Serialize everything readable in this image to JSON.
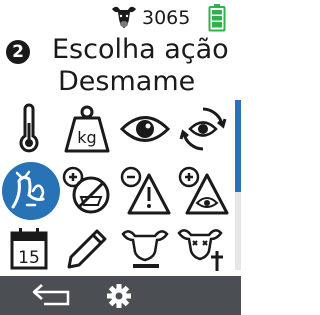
{
  "status_bar": {
    "animal_icon": "cow-head-icon",
    "animal_count": "3065",
    "battery_icon": "battery-full-icon",
    "battery_color": "#2fb24a"
  },
  "header": {
    "step_number": "2",
    "title": "Escolha ação",
    "subtitle": "Desmame"
  },
  "actions": [
    {
      "icon": "thermometer-icon"
    },
    {
      "icon": "weight-kg-icon"
    },
    {
      "icon": "eye-icon"
    },
    {
      "icon": "eye-rotate-icon"
    },
    {
      "icon": "weaning-cow-calf-icon",
      "selected": true
    },
    {
      "icon": "no-feeding-icon"
    },
    {
      "icon": "warning-minus-icon"
    },
    {
      "icon": "warning-eye-plus-icon"
    },
    {
      "icon": "calendar-icon",
      "label": "15"
    },
    {
      "icon": "pencil-icon"
    },
    {
      "icon": "cow-minus-icon"
    },
    {
      "icon": "cow-dead-icon"
    }
  ],
  "footer": {
    "back_icon": "back-arrow-icon",
    "settings_icon": "gear-icon"
  },
  "colors": {
    "accent": "#2872b6",
    "footer_bg": "#4b4f53",
    "icon_stroke": "#1a1a1a"
  },
  "scroll_position": 0.0
}
